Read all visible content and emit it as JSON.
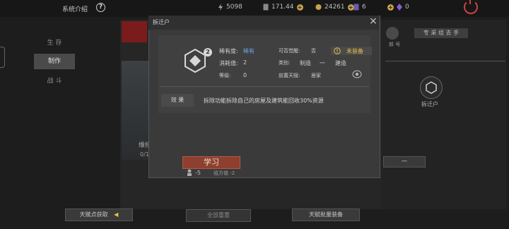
{
  "topbar": {
    "sys_title": "系统介绍",
    "help_glyph": "?",
    "res1": "5098",
    "res2": "171.44",
    "res3": "24261",
    "res4": "6",
    "res5": "0",
    "plus": "+"
  },
  "nav": {
    "items": [
      {
        "label": "生 存"
      },
      {
        "label": "制作"
      },
      {
        "label": "战 斗"
      }
    ]
  },
  "background": {
    "art_label": "维修",
    "art_count": "0/12"
  },
  "right_panel": {
    "title": "专 采 组 去 手",
    "name": "郎 号",
    "node_label": "拆迁户",
    "button": "一"
  },
  "popup": {
    "title": "拆迁户",
    "close_glyph": "×",
    "level_badge": "2",
    "rarity_label": "稀有度:",
    "rarity_value": "稀有",
    "awaken_label": "可否觉醒:",
    "awaken_value": "否",
    "equip_status": "未装备",
    "cost_label": "消耗值:",
    "cost_value": "2",
    "type_label": "类别:",
    "type_value1": "制造",
    "type_sep": "一",
    "type_value2": "建造",
    "level_label": "等级:",
    "level_value": "0",
    "preset_label": "前置天赋:",
    "preset_value": "居家",
    "effect_label": "效 果",
    "effect_text": "拆除功能拆除自己的房屋及建筑能回收30%资源",
    "learn": "学习",
    "cost_a": "-5",
    "cost_b": "组方值 -2"
  },
  "bottom": {
    "btn1": "天赋点获取",
    "btn2": "全部重置",
    "btn3": "天赋批量装备"
  },
  "colors": {
    "accent_red": "#8d3f30",
    "rarity_blue": "#6aa9e6",
    "equip_yellow": "#e2c24d"
  }
}
